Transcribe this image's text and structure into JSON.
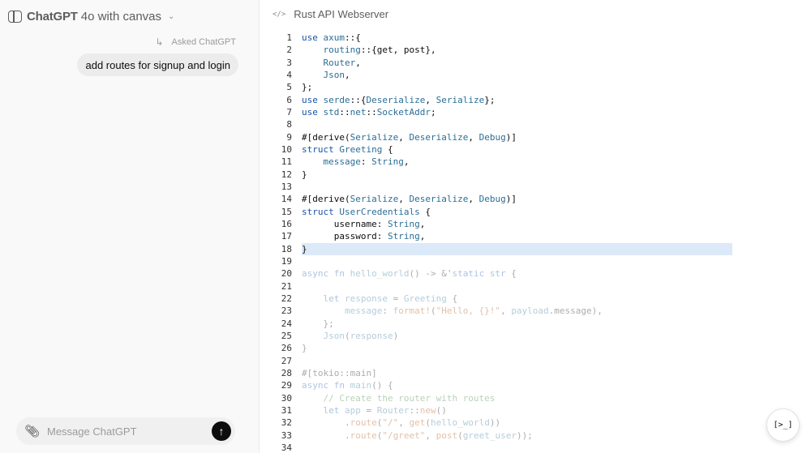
{
  "header": {
    "model_name": "ChatGPT",
    "model_variant": "4o with canvas"
  },
  "chat": {
    "asked_label": "Asked ChatGPT",
    "user_message": "add routes for signup and login"
  },
  "composer": {
    "placeholder": "Message ChatGPT"
  },
  "canvas": {
    "title": "Rust API Webserver",
    "highlighted_line": 18,
    "faded_from_line": 20,
    "lines": [
      [
        [
          "use ",
          "kw"
        ],
        [
          "axum",
          "ty"
        ],
        [
          "::{",
          ""
        ]
      ],
      [
        [
          "    ",
          ""
        ],
        [
          "routing",
          "ty"
        ],
        [
          "::{get, post},",
          ""
        ]
      ],
      [
        [
          "    ",
          ""
        ],
        [
          "Router",
          "ty"
        ],
        [
          ",",
          ""
        ]
      ],
      [
        [
          "    ",
          ""
        ],
        [
          "Json",
          "ty"
        ],
        [
          ",",
          ""
        ]
      ],
      [
        [
          "};",
          ""
        ]
      ],
      [
        [
          "use ",
          "kw"
        ],
        [
          "serde",
          "ty"
        ],
        [
          "::{",
          ""
        ],
        [
          "Deserialize",
          "ty"
        ],
        [
          ", ",
          ""
        ],
        [
          "Serialize",
          "ty"
        ],
        [
          "};",
          ""
        ]
      ],
      [
        [
          "use ",
          "kw"
        ],
        [
          "std",
          "ty"
        ],
        [
          "::",
          ""
        ],
        [
          "net",
          "ty"
        ],
        [
          "::",
          ""
        ],
        [
          "SocketAddr",
          "ty"
        ],
        [
          ";",
          ""
        ]
      ],
      [],
      [
        [
          "#[derive(",
          ""
        ],
        [
          "Serialize",
          "ty"
        ],
        [
          ", ",
          ""
        ],
        [
          "Deserialize",
          "ty"
        ],
        [
          ", ",
          ""
        ],
        [
          "Debug",
          "ty"
        ],
        [
          ")]",
          ""
        ]
      ],
      [
        [
          "struct ",
          "kw"
        ],
        [
          "Greeting",
          "ty"
        ],
        [
          " {",
          ""
        ]
      ],
      [
        [
          "    ",
          ""
        ],
        [
          "message",
          "ty"
        ],
        [
          ": ",
          ""
        ],
        [
          "String",
          "ty"
        ],
        [
          ",",
          ""
        ]
      ],
      [
        [
          "}",
          ""
        ]
      ],
      [],
      [
        [
          "#[derive(",
          ""
        ],
        [
          "Serialize",
          "ty"
        ],
        [
          ", ",
          ""
        ],
        [
          "Deserialize",
          "ty"
        ],
        [
          ", ",
          ""
        ],
        [
          "Debug",
          "ty"
        ],
        [
          ")]",
          ""
        ]
      ],
      [
        [
          "struct ",
          "kw"
        ],
        [
          "UserCredentials",
          "ty"
        ],
        [
          " {",
          ""
        ]
      ],
      [
        [
          "      username: ",
          ""
        ],
        [
          "String",
          "ty"
        ],
        [
          ",",
          ""
        ]
      ],
      [
        [
          "      password: ",
          ""
        ],
        [
          "String",
          "ty"
        ],
        [
          ",",
          ""
        ]
      ],
      [
        [
          "}",
          ""
        ]
      ],
      [],
      [
        [
          "async fn ",
          "kw"
        ],
        [
          "hello_world",
          "ty"
        ],
        [
          "() -> &'",
          ""
        ],
        [
          "static str",
          "kw"
        ],
        [
          " {",
          ""
        ]
      ],
      [],
      [
        [
          "    ",
          ""
        ],
        [
          "let ",
          "kw"
        ],
        [
          "response",
          "ty"
        ],
        [
          " = ",
          ""
        ],
        [
          "Greeting",
          "ty"
        ],
        [
          " {",
          ""
        ]
      ],
      [
        [
          "        ",
          ""
        ],
        [
          "message",
          "ty"
        ],
        [
          ": ",
          ""
        ],
        [
          "format!",
          "str"
        ],
        [
          "(",
          ""
        ],
        [
          "\"Hello, {}!\"",
          "str"
        ],
        [
          ", ",
          ""
        ],
        [
          "payload",
          "ty"
        ],
        [
          ".message),",
          ""
        ]
      ],
      [
        [
          "    };",
          ""
        ]
      ],
      [
        [
          "    ",
          ""
        ],
        [
          "Json",
          "ty"
        ],
        [
          "(",
          ""
        ],
        [
          "response",
          "ty"
        ],
        [
          ")",
          ""
        ]
      ],
      [
        [
          "}",
          ""
        ]
      ],
      [],
      [
        [
          "#[tokio::main]",
          ""
        ]
      ],
      [
        [
          "async fn ",
          "kw"
        ],
        [
          "main",
          "ty"
        ],
        [
          "() {",
          ""
        ]
      ],
      [
        [
          "    ",
          ""
        ],
        [
          "// Create the router with routes",
          "cm"
        ]
      ],
      [
        [
          "    ",
          ""
        ],
        [
          "let ",
          "kw"
        ],
        [
          "app",
          "ty"
        ],
        [
          " = ",
          ""
        ],
        [
          "Router",
          "ty"
        ],
        [
          "::",
          ""
        ],
        [
          "new",
          "str"
        ],
        [
          "()",
          ""
        ]
      ],
      [
        [
          "        .",
          ""
        ],
        [
          "route",
          "str"
        ],
        [
          "(",
          ""
        ],
        [
          "\"/\"",
          "str"
        ],
        [
          ", ",
          ""
        ],
        [
          "get",
          "str"
        ],
        [
          "(",
          ""
        ],
        [
          "hello_world",
          "ty"
        ],
        [
          "))",
          ""
        ]
      ],
      [
        [
          "        .",
          ""
        ],
        [
          "route",
          "str"
        ],
        [
          "(",
          ""
        ],
        [
          "\"/greet\"",
          "str"
        ],
        [
          ", ",
          ""
        ],
        [
          "post",
          "str"
        ],
        [
          "(",
          ""
        ],
        [
          "greet_user",
          "ty"
        ],
        [
          "));",
          ""
        ]
      ],
      []
    ]
  },
  "colors": {
    "kw": "#1753a8",
    "ty": "#2a6e96",
    "str": "#b04a00",
    "cm": "#3a7a3a",
    "highlight": "#dce9f8"
  },
  "icons": {
    "sidebar_toggle": "sidebar-icon",
    "chevron": "chevron-down-icon",
    "reply": "reply-arrow-icon",
    "attach": "paperclip-icon",
    "send": "arrow-up-icon",
    "code": "code-icon",
    "canvas_tools": "terminal-icon"
  }
}
